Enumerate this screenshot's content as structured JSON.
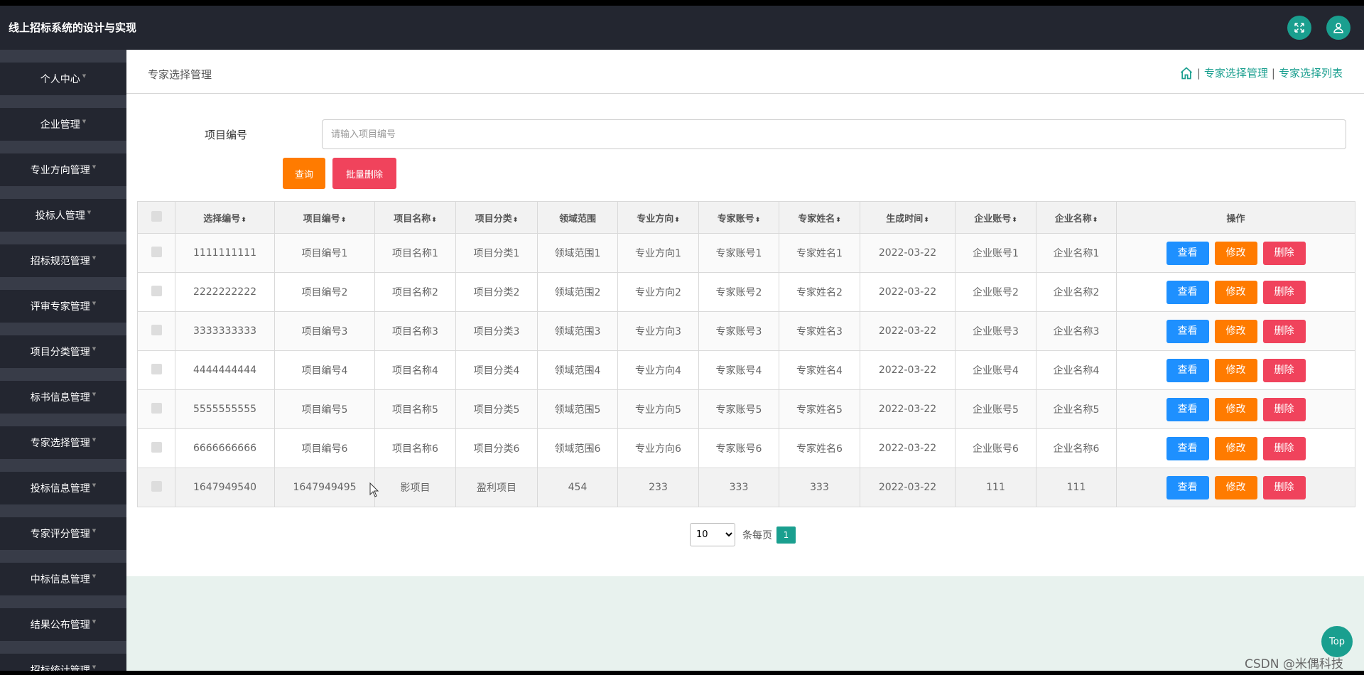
{
  "app": {
    "title": "线上招标系统的设计与实现"
  },
  "colors": {
    "accent": "#1a9f8f",
    "header_bg": "#232630",
    "orange": "#ff7b00",
    "red": "#f0435c",
    "blue": "#1e90ff"
  },
  "icons": {
    "fullscreen": "fullscreen-icon",
    "user": "user-icon",
    "home": "home-icon"
  },
  "sidebar": {
    "items": [
      {
        "label": "个人中心"
      },
      {
        "label": "企业管理"
      },
      {
        "label": "专业方向管理"
      },
      {
        "label": "投标人管理"
      },
      {
        "label": "招标规范管理"
      },
      {
        "label": "评审专家管理"
      },
      {
        "label": "项目分类管理"
      },
      {
        "label": "标书信息管理"
      },
      {
        "label": "专家选择管理"
      },
      {
        "label": "投标信息管理"
      },
      {
        "label": "专家评分管理"
      },
      {
        "label": "中标信息管理"
      },
      {
        "label": "结果公布管理"
      },
      {
        "label": "招标统计管理"
      }
    ]
  },
  "page": {
    "title": "专家选择管理",
    "breadcrumb": [
      "专家选择管理",
      "专家选择列表"
    ],
    "separator": "|"
  },
  "search": {
    "label": "项目编号",
    "placeholder": "请输入项目编号",
    "query_label": "查询",
    "batch_delete_label": "批量删除"
  },
  "table": {
    "headers": [
      "选择编号",
      "项目编号",
      "项目名称",
      "项目分类",
      "领域范围",
      "专业方向",
      "专家账号",
      "专家姓名",
      "生成时间",
      "企业账号",
      "企业名称",
      "操作"
    ],
    "sortable": [
      true,
      true,
      true,
      true,
      false,
      true,
      true,
      true,
      true,
      true,
      true,
      false
    ],
    "actions": {
      "view": "查看",
      "edit": "修改",
      "delete": "删除"
    },
    "rows": [
      [
        "1111111111",
        "项目编号1",
        "项目名称1",
        "项目分类1",
        "领域范围1",
        "专业方向1",
        "专家账号1",
        "专家姓名1",
        "2022-03-22",
        "企业账号1",
        "企业名称1"
      ],
      [
        "2222222222",
        "项目编号2",
        "项目名称2",
        "项目分类2",
        "领域范围2",
        "专业方向2",
        "专家账号2",
        "专家姓名2",
        "2022-03-22",
        "企业账号2",
        "企业名称2"
      ],
      [
        "3333333333",
        "项目编号3",
        "项目名称3",
        "项目分类3",
        "领域范围3",
        "专业方向3",
        "专家账号3",
        "专家姓名3",
        "2022-03-22",
        "企业账号3",
        "企业名称3"
      ],
      [
        "4444444444",
        "项目编号4",
        "项目名称4",
        "项目分类4",
        "领域范围4",
        "专业方向4",
        "专家账号4",
        "专家姓名4",
        "2022-03-22",
        "企业账号4",
        "企业名称4"
      ],
      [
        "5555555555",
        "项目编号5",
        "项目名称5",
        "项目分类5",
        "领域范围5",
        "专业方向5",
        "专家账号5",
        "专家姓名5",
        "2022-03-22",
        "企业账号5",
        "企业名称5"
      ],
      [
        "6666666666",
        "项目编号6",
        "项目名称6",
        "项目分类6",
        "领域范围6",
        "专业方向6",
        "专家账号6",
        "专家姓名6",
        "2022-03-22",
        "企业账号6",
        "企业名称6"
      ],
      [
        "1647949540",
        "1647949495",
        "影项目",
        "盈利项目",
        "454",
        "233",
        "333",
        "333",
        "2022-03-22",
        "111",
        "111"
      ]
    ]
  },
  "pagination": {
    "page_size": "10",
    "page_size_options": [
      "10"
    ],
    "per_page_label": "条每页",
    "current_page": "1"
  },
  "top_button": "Top",
  "watermark": "CSDN @米偶科技"
}
